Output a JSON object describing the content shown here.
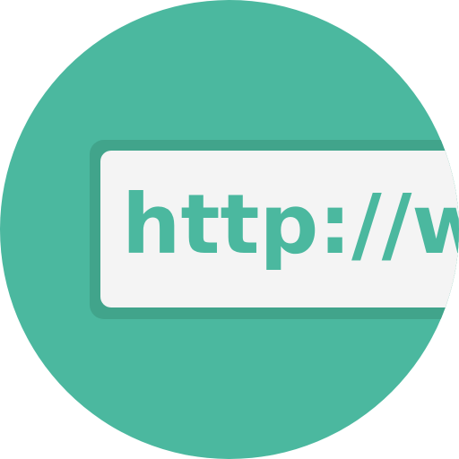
{
  "icon": {
    "name": "url-address-bar-icon",
    "url_text": "http://ww",
    "colors": {
      "circle": "#4bb89f",
      "bar_border": "#41a48b",
      "bar_field": "#f4f4f4",
      "text": "#4bb89f"
    }
  }
}
